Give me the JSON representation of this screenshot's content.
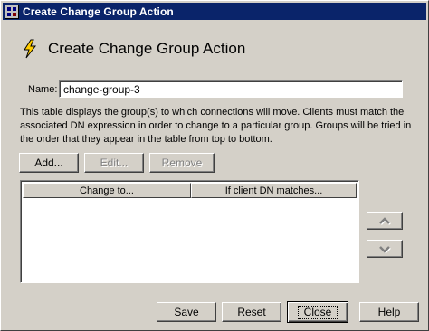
{
  "window": {
    "title": "Create Change Group Action"
  },
  "header": {
    "title": "Create Change Group Action"
  },
  "form": {
    "name_label": "Name:",
    "name_value": "change-group-3"
  },
  "description": "This table displays the group(s) to which connections will move.  Clients must match the associated DN expression in order to change to a particular group.  Groups will be tried in the order that they appear in the table from top to bottom.",
  "toolbar": {
    "add_label": "Add...",
    "edit_label": "Edit...",
    "remove_label": "Remove"
  },
  "table": {
    "columns": [
      "Change to...",
      "If client DN matches..."
    ],
    "rows": []
  },
  "footer": {
    "save_label": "Save",
    "reset_label": "Reset",
    "close_label": "Close",
    "help_label": "Help"
  },
  "colors": {
    "titlebar": "#0a246a",
    "window_face": "#d4d0c8",
    "bolt": "#ffcc00"
  },
  "icons": {
    "title": "app-window-icon",
    "heading": "lightning-bolt-icon",
    "move_up": "arrow-up-icon",
    "move_down": "arrow-down-icon"
  }
}
